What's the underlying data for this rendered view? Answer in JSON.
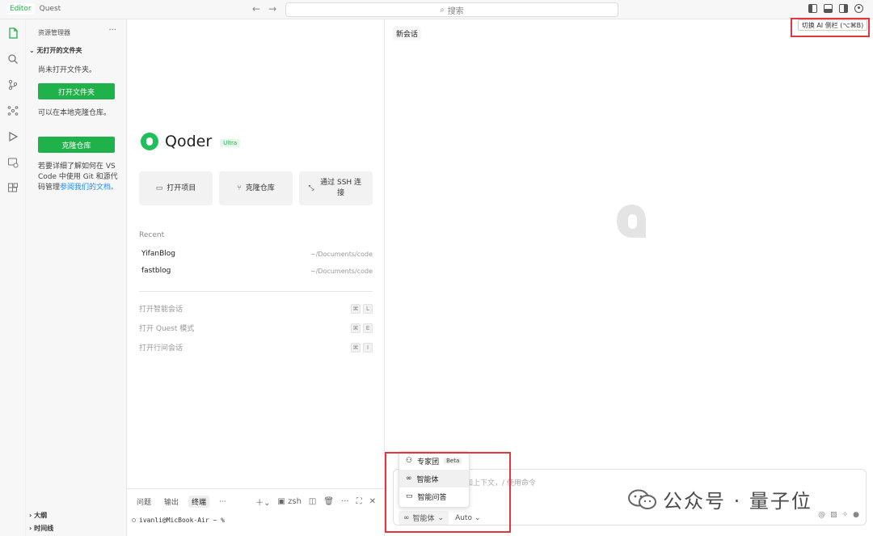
{
  "titlebar": {
    "tab_editor": "Editor",
    "tab_quest": "Quest",
    "search_placeholder": "搜索"
  },
  "sidebar": {
    "title": "资源管理器",
    "more": "···",
    "folder_header": "无打开的文件夹",
    "no_folder_text": "尚未打开文件夹。",
    "open_folder_btn": "打开文件夹",
    "clone_hint": "可以在本地克隆仓库。",
    "clone_btn": "克隆仓库",
    "learn_more_prefix": "若要详细了解如何在 VS Code 中使用 Git 和源代码管理",
    "learn_more_link": "参阅我们的文档。",
    "outline": "大纲",
    "timeline": "时间线"
  },
  "welcome": {
    "product_name": "Qoder",
    "badge": "Ultra",
    "actions": [
      {
        "label": "打开项目",
        "icon": "folder-icon"
      },
      {
        "label": "克隆仓库",
        "icon": "git-branch-icon"
      },
      {
        "label": "通过 SSH 连接",
        "icon": "remote-icon"
      }
    ],
    "recent_title": "Recent",
    "recent": [
      {
        "name": "YifanBlog",
        "path": "~/Documents/code"
      },
      {
        "name": "fastblog",
        "path": "~/Documents/code"
      }
    ],
    "commands": [
      {
        "label": "打开智能会话",
        "keys": [
          "⌘",
          "L"
        ]
      },
      {
        "label": "打开 Quest 模式",
        "keys": [
          "⌘",
          "E"
        ]
      },
      {
        "label": "打开行间会话",
        "keys": [
          "⌘",
          "I"
        ]
      }
    ]
  },
  "terminal": {
    "tabs": [
      "问题",
      "输出",
      "终端",
      "···"
    ],
    "shell": "zsh",
    "prompt": "ivanli@MicBook-Air ~ %"
  },
  "ai_panel": {
    "new_chat": "新会话",
    "tooltip": "切换 AI 侧栏 (⌥⌘B)",
    "input_placeholder": "添加上下文，/ 使用命令",
    "mode_label": "智能体",
    "model_label": "Auto",
    "dropdown": [
      {
        "label": "专家团",
        "badge": "Beta",
        "icon": "team-icon"
      },
      {
        "label": "智能体",
        "icon": "infinity-icon"
      },
      {
        "label": "智能问答",
        "icon": "chat-icon"
      }
    ]
  },
  "watermark": "公众号 · 量子位",
  "colors": {
    "accent": "#20b24a",
    "highlight_box": "#e0383e",
    "link": "#1a8cff"
  }
}
